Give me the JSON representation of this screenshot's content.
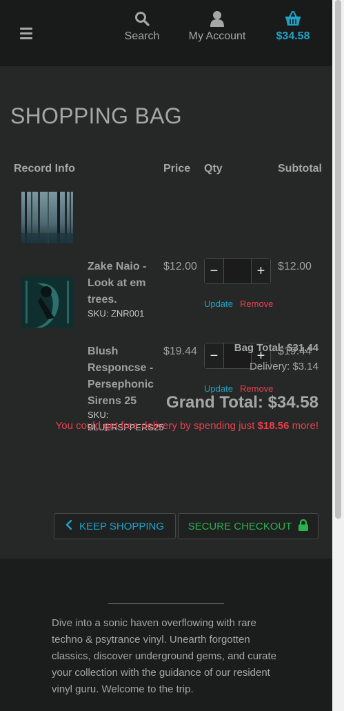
{
  "header": {
    "search_label": "Search",
    "account_label": "My Account",
    "cart_total": "$34.58",
    "accent_color": "#1fa3c7"
  },
  "main": {
    "title": "SHOPPING BAG",
    "columns": {
      "record_info": "Record Info",
      "price": "Price",
      "qty": "Qty",
      "subtotal": "Subtotal"
    },
    "items": [
      {
        "name": "Zake Naio - Look at em trees.",
        "sku": "SKU: ZNR001",
        "price": "$12.00",
        "subtotal": "$12.00",
        "update": "Update",
        "remove": "Remove"
      },
      {
        "name": "Blush Responcse - Persephonic Sirens 25",
        "sku": "SKU: BLUERSPPERS25",
        "price": "$19.44",
        "subtotal": "$19.44",
        "update": "Update",
        "remove": "Remove"
      }
    ],
    "bag_total": "Bag Total: $31.44",
    "delivery": "Delivery: $3.14",
    "grand_total": "Grand Total: $34.58",
    "free_delivery_prefix": "You could get free delivery by spending just ",
    "free_delivery_amount": "$18.56",
    "free_delivery_suffix": " more!",
    "keep_shopping": "KEEP SHOPPING",
    "secure_checkout": "SECURE CHECKOUT",
    "remove_color": "#e8424f",
    "checkout_color": "#2bb24c"
  },
  "footer": {
    "blurb": "Dive into a sonic haven overflowing with rare techno & psytrance vinyl. Unearth forgotten classics, discover underground gems, and curate your collection with the guidance of our resident vinyl guru. Welcome to the trip."
  }
}
